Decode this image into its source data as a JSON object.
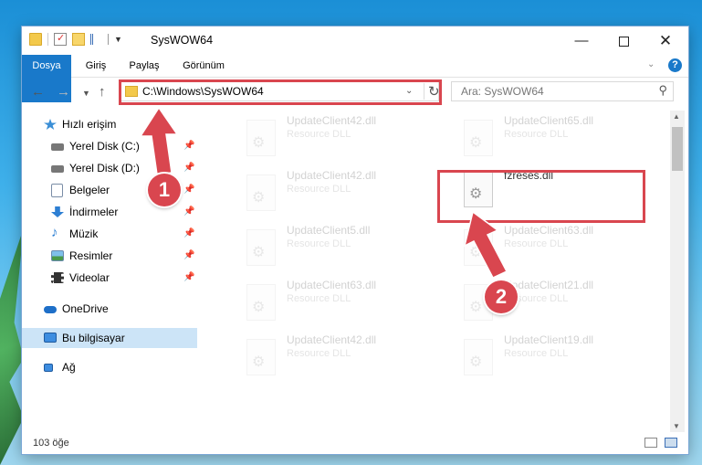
{
  "window": {
    "title": "SysWOW64"
  },
  "ribbon": {
    "tabs": [
      "Dosya",
      "Giriş",
      "Paylaş",
      "Görünüm"
    ],
    "help_label": "?"
  },
  "address": {
    "path": "C:\\Windows\\SysWOW64"
  },
  "search": {
    "placeholder": "Ara: SysWOW64"
  },
  "nav_pane": {
    "items": [
      {
        "label": "Hızlı erişim",
        "icon": "star-icon",
        "pinned": false
      },
      {
        "label": "Yerel Disk (C:)",
        "icon": "drive-icon",
        "pinned": true
      },
      {
        "label": "Yerel Disk (D:)",
        "icon": "drive-icon",
        "pinned": true
      },
      {
        "label": "Belgeler",
        "icon": "documents-icon",
        "pinned": true
      },
      {
        "label": "İndirmeler",
        "icon": "download-icon",
        "pinned": true
      },
      {
        "label": "Müzik",
        "icon": "music-icon",
        "pinned": true
      },
      {
        "label": "Resimler",
        "icon": "pictures-icon",
        "pinned": true
      },
      {
        "label": "Videolar",
        "icon": "video-icon",
        "pinned": true
      },
      {
        "label": "OneDrive",
        "icon": "cloud-icon",
        "pinned": false
      },
      {
        "label": "Bu bilgisayar",
        "icon": "computer-icon",
        "pinned": false
      },
      {
        "label": "Ağ",
        "icon": "network-icon",
        "pinned": false
      }
    ],
    "selected": "Bu bilgisayar"
  },
  "files": [
    {
      "name": "UpdateClient42.dll",
      "type": "Resource DLL",
      "faded": true
    },
    {
      "name": "UpdateClient65.dll",
      "type": "Resource DLL",
      "faded": true
    },
    {
      "name": "UpdateClient42.dll",
      "type": "Resource DLL",
      "faded": true
    },
    {
      "name": "fzreses.dll",
      "type": "",
      "faded": false
    },
    {
      "name": "UpdateClient5.dll",
      "type": "Resource DLL",
      "faded": true
    },
    {
      "name": "UpdateClient63.dll",
      "type": "Resource DLL",
      "faded": true
    },
    {
      "name": "UpdateClient63.dll",
      "type": "Resource DLL",
      "faded": true
    },
    {
      "name": "UpdateClient21.dll",
      "type": "Resource DLL",
      "faded": true
    },
    {
      "name": "UpdateClient42.dll",
      "type": "Resource DLL",
      "faded": true
    },
    {
      "name": "UpdateClient19.dll",
      "type": "Resource DLL",
      "faded": true
    }
  ],
  "status": {
    "item_count": "103 öğe"
  },
  "annotations": {
    "step1": "1",
    "step2": "2",
    "color": "#d9464f"
  }
}
